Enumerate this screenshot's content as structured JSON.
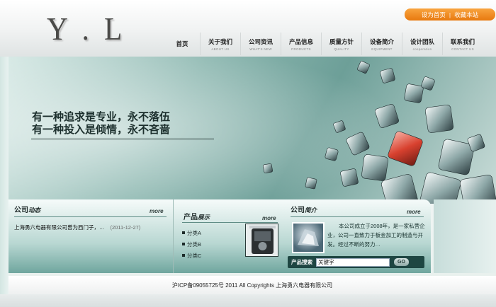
{
  "logo": "Y . L",
  "header_links": {
    "set_home": "设为首页",
    "separator": "|",
    "bookmark": "收藏本站"
  },
  "nav": [
    {
      "cn": "首页",
      "en": ""
    },
    {
      "cn": "关于我们",
      "en": "ABOUT US"
    },
    {
      "cn": "公司资讯",
      "en": "WHAT'S NEW"
    },
    {
      "cn": "产品信息",
      "en": "PRODUCTS"
    },
    {
      "cn": "质量方针",
      "en": "QUALITY"
    },
    {
      "cn": "设备简介",
      "en": "EQUIPMENT"
    },
    {
      "cn": "设计团队",
      "en": "cooperation"
    },
    {
      "cn": "联系我们",
      "en": "CONTACT US"
    }
  ],
  "banner": {
    "slogan_line1": "有一种追求是专业，永不落伍",
    "slogan_line2": "有一种投入是倾情，永不吝啬"
  },
  "news": {
    "title_main": "公司",
    "title_accent": "动态",
    "more": "more",
    "items": [
      {
        "text": "上海勇六电器有限公司曾为西门子，…",
        "date": "(2011-12-27)"
      }
    ]
  },
  "products": {
    "title_main": "产品",
    "title_accent": "展示",
    "more": "more",
    "items": [
      "分类A",
      "分类B",
      "分类C"
    ]
  },
  "about": {
    "title_main": "公司",
    "title_accent": "简介",
    "more": "more",
    "text": "本公司成立于2008年，是一家私营企业，公司一直致力于板金加工的制造与开发。经过不断的努力…",
    "search_label": "产品搜索",
    "search_value": "关键字",
    "search_button": "GO"
  },
  "footer": {
    "text": "沪ICP备09055725号  2011 All Copyrights 上海勇六电器有限公司"
  },
  "colors": {
    "accent_orange": "#f08a1d",
    "panel_dark": "#1e4642",
    "banner_cube_red": "#d8412f"
  }
}
